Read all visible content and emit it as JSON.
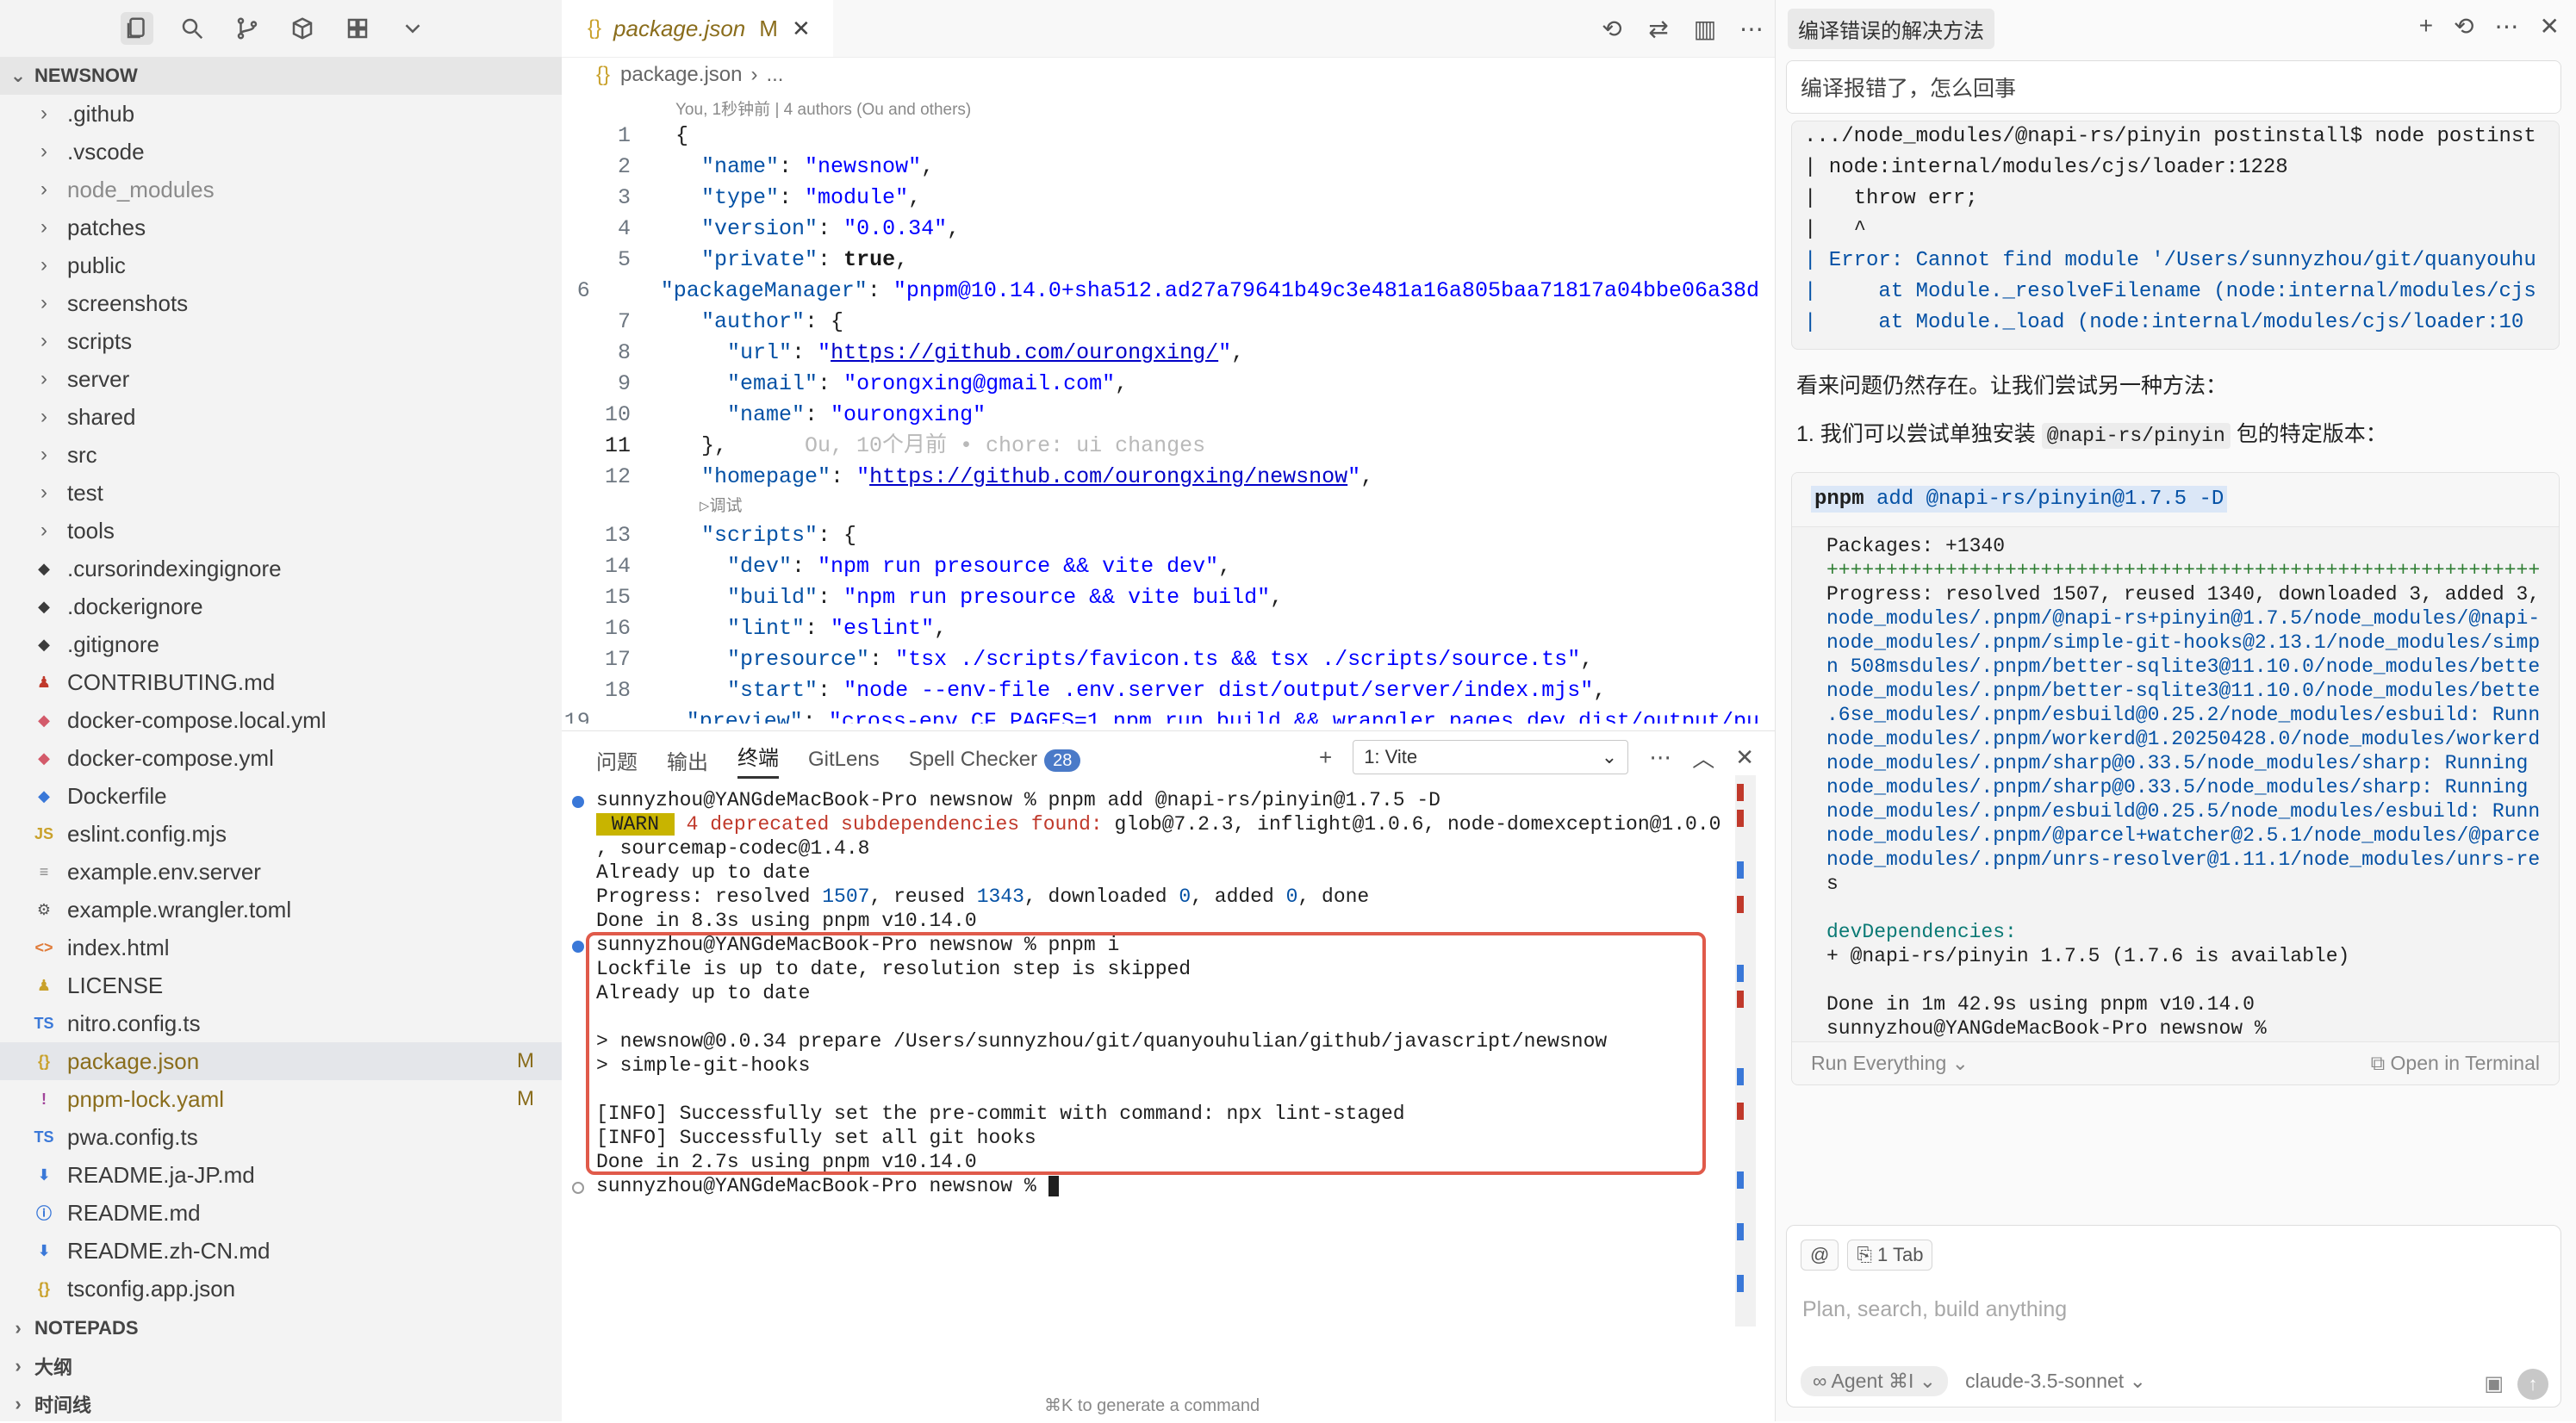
{
  "sidebar": {
    "project": "NEWSNOW",
    "items": [
      {
        "label": ".github",
        "kind": "folder",
        "icon": "chevron-right-icon"
      },
      {
        "label": ".vscode",
        "kind": "folder",
        "icon": "chevron-right-icon"
      },
      {
        "label": "node_modules",
        "kind": "folder",
        "icon": "chevron-right-icon",
        "dim": true
      },
      {
        "label": "patches",
        "kind": "folder",
        "icon": "chevron-right-icon"
      },
      {
        "label": "public",
        "kind": "folder",
        "icon": "chevron-right-icon"
      },
      {
        "label": "screenshots",
        "kind": "folder",
        "icon": "chevron-right-icon"
      },
      {
        "label": "scripts",
        "kind": "folder",
        "icon": "chevron-right-icon"
      },
      {
        "label": "server",
        "kind": "folder",
        "icon": "chevron-right-icon"
      },
      {
        "label": "shared",
        "kind": "folder",
        "icon": "chevron-right-icon"
      },
      {
        "label": "src",
        "kind": "folder",
        "icon": "chevron-right-icon"
      },
      {
        "label": "test",
        "kind": "folder",
        "icon": "chevron-right-icon"
      },
      {
        "label": "tools",
        "kind": "folder",
        "icon": "chevron-right-icon"
      },
      {
        "label": ".cursorindexingignore",
        "kind": "file",
        "icon": "ignore-file-icon",
        "glyph": "◆",
        "color": "#3b3b3b"
      },
      {
        "label": ".dockerignore",
        "kind": "file",
        "icon": "docker-icon",
        "glyph": "◆",
        "color": "#3b3b3b"
      },
      {
        "label": ".gitignore",
        "kind": "file",
        "icon": "git-icon",
        "glyph": "◆",
        "color": "#3b3b3b"
      },
      {
        "label": "CONTRIBUTING.md",
        "kind": "file",
        "icon": "contributing-icon",
        "glyph": "♟",
        "color": "#c0392b"
      },
      {
        "label": "docker-compose.local.yml",
        "kind": "file",
        "icon": "docker-compose-icon",
        "glyph": "◆",
        "color": "#d35a6a"
      },
      {
        "label": "docker-compose.yml",
        "kind": "file",
        "icon": "docker-compose-icon",
        "glyph": "◆",
        "color": "#d35a6a"
      },
      {
        "label": "Dockerfile",
        "kind": "file",
        "icon": "dockerfile-icon",
        "glyph": "◆",
        "color": "#3a78d8"
      },
      {
        "label": "eslint.config.mjs",
        "kind": "file",
        "icon": "js-file-icon",
        "glyph": "JS",
        "color": "#c9a12b"
      },
      {
        "label": "example.env.server",
        "kind": "file",
        "icon": "text-file-icon",
        "glyph": "≡",
        "color": "#888"
      },
      {
        "label": "example.wrangler.toml",
        "kind": "file",
        "icon": "gear-file-icon",
        "glyph": "⚙",
        "color": "#555"
      },
      {
        "label": "index.html",
        "kind": "file",
        "icon": "html-file-icon",
        "glyph": "<>",
        "color": "#e07b39"
      },
      {
        "label": "LICENSE",
        "kind": "file",
        "icon": "license-icon",
        "glyph": "♟",
        "color": "#c9a12b"
      },
      {
        "label": "nitro.config.ts",
        "kind": "file",
        "icon": "ts-file-icon",
        "glyph": "TS",
        "color": "#3a78d8"
      },
      {
        "label": "package.json",
        "kind": "file",
        "icon": "json-file-icon",
        "glyph": "{}",
        "color": "#c9a12b",
        "selected": true,
        "badge": "M"
      },
      {
        "label": "pnpm-lock.yaml",
        "kind": "file",
        "icon": "yaml-file-icon",
        "glyph": "!",
        "color": "#a0449a",
        "badge": "M"
      },
      {
        "label": "pwa.config.ts",
        "kind": "file",
        "icon": "ts-file-icon",
        "glyph": "TS",
        "color": "#3a78d8"
      },
      {
        "label": "README.ja-JP.md",
        "kind": "file",
        "icon": "readme-icon",
        "glyph": "⬇",
        "color": "#3a78d8"
      },
      {
        "label": "README.md",
        "kind": "file",
        "icon": "info-icon",
        "glyph": "ⓘ",
        "color": "#3a78d8"
      },
      {
        "label": "README.zh-CN.md",
        "kind": "file",
        "icon": "readme-icon",
        "glyph": "⬇",
        "color": "#3a78d8"
      },
      {
        "label": "tsconfig.app.json",
        "kind": "file",
        "icon": "json-file-icon",
        "glyph": "{}",
        "color": "#c9a12b"
      }
    ],
    "sections": [
      "NOTEPADS",
      "大纲",
      "时间线"
    ]
  },
  "editor": {
    "tab": {
      "icon_glyph": "{}",
      "label": "package.json",
      "status": "M",
      "close": "✕"
    },
    "actions": [
      "history-icon",
      "compare-icon",
      "split-editor-icon",
      "more-icon"
    ],
    "actions_glyphs": [
      "⟲",
      "⇄",
      "▥",
      "⋯"
    ],
    "breadcrumb": {
      "file": "package.json",
      "sep": "›",
      "more": "..."
    },
    "blame": "You, 1秒钟前 | 4 authors (Ou and others)",
    "debug_hint": "▷调试"
  },
  "panel": {
    "tabs": [
      "问题",
      "输出",
      "终端",
      "GitLens",
      "Spell Checker"
    ],
    "spell_count": "28",
    "active_tab": "终端",
    "terminal_select": "1: Vite",
    "actions_glyphs": [
      "+",
      "⋯",
      "︿",
      "✕"
    ],
    "lines": [
      {
        "dot": "blue",
        "text": "sunnyzhou@YANGdeMacBook-Pro newsnow % pnpm add @napi-rs/pinyin@1.7.5 -D"
      },
      {
        "warn": " WARN ",
        "red": " 4 deprecated subdependencies found:",
        "text": " glob@7.2.3, inflight@1.0.6, node-domexception@1.0.0"
      },
      {
        "text": ", sourcemap-codec@1.4.8"
      },
      {
        "text": "Already up to date"
      },
      {
        "prog": [
          "Progress: resolved ",
          "1507",
          ", reused ",
          "1343",
          ", downloaded ",
          "0",
          ", added ",
          "0",
          ", done"
        ]
      },
      {
        "text": "Done in 8.3s using pnpm v10.14.0"
      },
      {
        "dot": "blue",
        "text": "sunnyzhou@YANGdeMacBook-Pro newsnow % pnpm i"
      },
      {
        "text": "Lockfile is up to date, resolution step is skipped"
      },
      {
        "text": "Already up to date"
      },
      {
        "text": ""
      },
      {
        "text": "> newsnow@0.0.34 prepare /Users/sunnyzhou/git/quanyouhulian/github/javascript/newsnow"
      },
      {
        "text": "> simple-git-hooks"
      },
      {
        "text": ""
      },
      {
        "text": "[INFO] Successfully set the pre-commit with command: npx lint-staged"
      },
      {
        "text": "[INFO] Successfully set all git hooks"
      },
      {
        "text": "Done in 2.7s using pnpm v10.14.0"
      },
      {
        "dot": "hollow",
        "text": "sunnyzhou@YANGdeMacBook-Pro newsnow % ",
        "cursor": true
      }
    ],
    "footer_hint": "⌘K to generate a command"
  },
  "chat": {
    "title": "编译错误的解决方法",
    "header_actions": [
      "+",
      "⟲",
      "⋯",
      "✕"
    ],
    "query": "编译报错了，怎么回事",
    "error_lines": [
      ".../node_modules/@napi-rs/pinyin postinstall$ node postinst",
      "| node:internal/modules/cjs/loader:1228",
      "|   throw err;",
      "|   ^",
      "| Error: Cannot find module '/Users/sunnyzhou/git/quanyouhu",
      "|     at Module._resolveFilename (node:internal/modules/cjs",
      "|     at Module._load (node:internal/modules/cjs/loader:10"
    ],
    "para1": "看来问题仍然存在。让我们尝试另一种方法：",
    "para2_prefix": "1. 我们可以尝试单独安装 ",
    "para2_code": "@napi-rs/pinyin",
    "para2_suffix": " 包的特定版本：",
    "cmd_bin": "pnpm",
    "cmd_rest": " add @napi-rs/pinyin@1.7.5 -D",
    "output": [
      "Packages: +1340",
      "++++++++++++++++++++++++++++++++++++++++++++++++++++++++++++",
      "Progress: resolved 1507, reused 1340, downloaded 3, added 3,",
      "node_modules/.pnpm/@napi-rs+pinyin@1.7.5/node_modules/@napi-",
      "node_modules/.pnpm/simple-git-hooks@2.13.1/node_modules/simp",
      "n 508msdules/.pnpm/better-sqlite3@11.10.0/node_modules/bette",
      "node_modules/.pnpm/better-sqlite3@11.10.0/node_modules/bette",
      ".6se_modules/.pnpm/esbuild@0.25.2/node_modules/esbuild: Runn",
      "node_modules/.pnpm/workerd@1.20250428.0/node_modules/workerd",
      "node_modules/.pnpm/sharp@0.33.5/node_modules/sharp: Running",
      "node_modules/.pnpm/sharp@0.33.5/node_modules/sharp: Running",
      "node_modules/.pnpm/esbuild@0.25.5/node_modules/esbuild: Runn",
      "node_modules/.pnpm/@parcel+watcher@2.5.1/node_modules/@parce",
      "node_modules/.pnpm/unrs-resolver@1.11.1/node_modules/unrs-re",
      "s",
      "",
      "devDependencies:",
      "+ @napi-rs/pinyin 1.7.5 (1.7.6 is available)",
      "",
      "Done in 1m 42.9s using pnpm v10.14.0",
      "sunnyzhou@YANGdeMacBook-Pro newsnow % "
    ],
    "run_label": "Run Everything ⌄",
    "open_terminal": "⧉ Open in Terminal",
    "composer": {
      "at_chip": "@",
      "tab_chip": "⎘ 1 Tab",
      "placeholder": "Plan, search, build anything",
      "agent": "∞ Agent ⌘I ⌄",
      "model": "claude-3.5-sonnet ⌄",
      "send": "↑",
      "image": "▣"
    }
  },
  "colors": {
    "accent": "#3a78d8",
    "modified": "#8a6d1c",
    "highlight_box": "#e05a4a"
  }
}
